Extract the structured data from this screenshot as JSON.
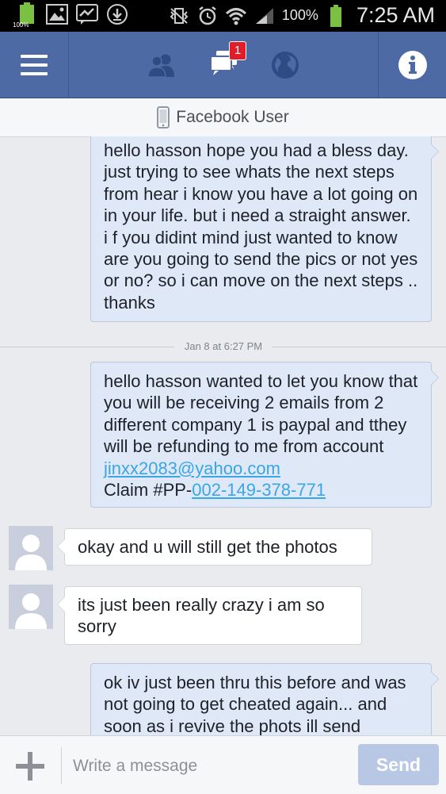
{
  "status_bar": {
    "battery_small": "100%",
    "battery_pct": "100%",
    "time": "7:25 AM"
  },
  "nav": {
    "messages_badge": "1"
  },
  "header": {
    "contact_name": "Facebook User"
  },
  "messages": [
    {
      "direction": "out",
      "text": "hello hasson hope  you had a bless day. just trying to see whats the next steps from hear i know you have a lot going on in your life. but  i need a straight answer. i f you didint mind just wanted to know are you going to send the pics or not yes or no? so i can move on the next steps .. thanks"
    },
    {
      "direction": "out",
      "text_before": "hello hasson wanted to let you know that you will be receiving 2 emails from 2 different company 1 is paypal and tthey will be refunding to me from account ",
      "email_link": "jinxx2083@yahoo.com",
      "claim_prefix": "Claim #PP-",
      "claim_link": "002-149-378-771"
    },
    {
      "direction": "in",
      "text": "okay and u will still get the photos"
    },
    {
      "direction": "in",
      "text": "its just been really crazy i am so sorry"
    },
    {
      "direction": "out",
      "text": "ok iv just been thru this before and was not going to get cheated again... and soon as i revive the phots ill send"
    }
  ],
  "timestamp_divider": "Jan 8 at 6:27 PM",
  "composer": {
    "placeholder": "Write a message",
    "send_label": "Send"
  },
  "colors": {
    "nav_bg": "#4d6aa5",
    "outgoing_bubble": "#dfe8f6",
    "link": "#3aa6e6",
    "send_button": "#b8c7e3"
  }
}
